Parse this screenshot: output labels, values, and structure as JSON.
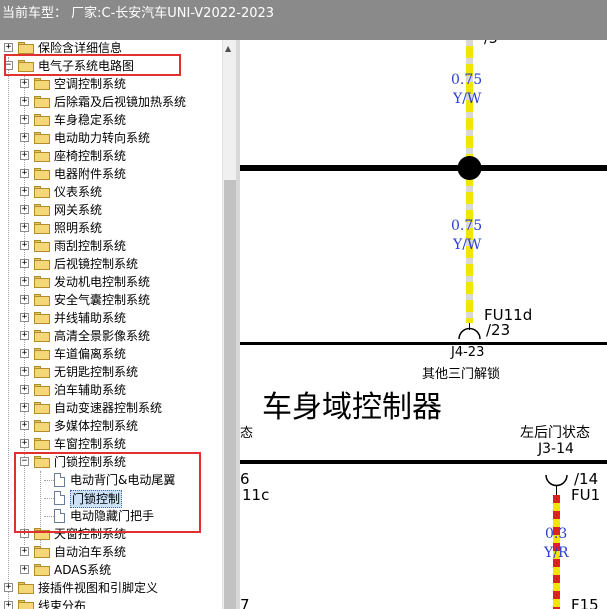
{
  "title": {
    "text": "当前车型：  厂家:C-长安汽车UNI-V2022-2023"
  },
  "tree": {
    "items": [
      {
        "label": "保险含详细信息",
        "level": 0,
        "state": "collapsed",
        "kind": "folder"
      },
      {
        "label": "电气子系统电路图",
        "level": 0,
        "state": "expanded",
        "kind": "folder"
      },
      {
        "label": "空调控制系统",
        "level": 1,
        "state": "collapsed",
        "kind": "folder"
      },
      {
        "label": "后除霜及后视镜加热系统",
        "level": 1,
        "state": "collapsed",
        "kind": "folder"
      },
      {
        "label": "车身稳定系统",
        "level": 1,
        "state": "collapsed",
        "kind": "folder"
      },
      {
        "label": "电动助力转向系统",
        "level": 1,
        "state": "collapsed",
        "kind": "folder"
      },
      {
        "label": "座椅控制系统",
        "level": 1,
        "state": "collapsed",
        "kind": "folder"
      },
      {
        "label": "电器附件系统",
        "level": 1,
        "state": "collapsed",
        "kind": "folder"
      },
      {
        "label": "仪表系统",
        "level": 1,
        "state": "collapsed",
        "kind": "folder"
      },
      {
        "label": "网关系统",
        "level": 1,
        "state": "collapsed",
        "kind": "folder"
      },
      {
        "label": "照明系统",
        "level": 1,
        "state": "collapsed",
        "kind": "folder"
      },
      {
        "label": "雨刮控制系统",
        "level": 1,
        "state": "collapsed",
        "kind": "folder"
      },
      {
        "label": "后视镜控制系统",
        "level": 1,
        "state": "collapsed",
        "kind": "folder"
      },
      {
        "label": "发动机电控制系统",
        "level": 1,
        "state": "collapsed",
        "kind": "folder"
      },
      {
        "label": "安全气囊控制系统",
        "level": 1,
        "state": "collapsed",
        "kind": "folder"
      },
      {
        "label": "并线辅助系统",
        "level": 1,
        "state": "collapsed",
        "kind": "folder"
      },
      {
        "label": "高清全景影像系统",
        "level": 1,
        "state": "collapsed",
        "kind": "folder"
      },
      {
        "label": "车道偏离系统",
        "level": 1,
        "state": "collapsed",
        "kind": "folder"
      },
      {
        "label": "无钥匙控制系统",
        "level": 1,
        "state": "collapsed",
        "kind": "folder"
      },
      {
        "label": "泊车辅助系统",
        "level": 1,
        "state": "collapsed",
        "kind": "folder"
      },
      {
        "label": "自动变速器控制系统",
        "level": 1,
        "state": "collapsed",
        "kind": "folder"
      },
      {
        "label": "多媒体控制系统",
        "level": 1,
        "state": "collapsed",
        "kind": "folder"
      },
      {
        "label": "车窗控制系统",
        "level": 1,
        "state": "collapsed",
        "kind": "folder"
      },
      {
        "label": "门锁控制系统",
        "level": 1,
        "state": "expanded",
        "kind": "folder"
      },
      {
        "label": "电动背门&电动尾翼",
        "level": 2,
        "state": "leaf",
        "kind": "doc"
      },
      {
        "label": "门锁控制",
        "level": 2,
        "state": "leaf",
        "kind": "doc",
        "selected": true
      },
      {
        "label": "电动隐藏门把手",
        "level": 2,
        "state": "leaf",
        "kind": "doc"
      },
      {
        "label": "天窗控制系统",
        "level": 1,
        "state": "collapsed",
        "kind": "folder"
      },
      {
        "label": "自动泊车系统",
        "level": 1,
        "state": "collapsed",
        "kind": "folder"
      },
      {
        "label": "ADAS系统",
        "level": 1,
        "state": "collapsed",
        "kind": "folder"
      },
      {
        "label": "接插件视图和引脚定义",
        "level": 0,
        "state": "collapsed",
        "kind": "folder"
      },
      {
        "label": "线束分布",
        "level": 0,
        "state": "collapsed",
        "kind": "folder"
      }
    ]
  },
  "diagram": {
    "wire1_size": "0.75",
    "wire1_color": "Y/W",
    "wire2_size": "0.75",
    "wire2_color": "Y/W",
    "top_pin_fragment": "/3",
    "fuse_label": "FU11d",
    "fuse_pin": "/23",
    "connector_pin": "J4-23",
    "connector_desc": "其他三门解锁",
    "module_title": "车身域控制器",
    "left_fragment": "态",
    "rear_door_status": "左后门状态",
    "rear_door_pin": "J3-14",
    "left_num_fragment": "6",
    "left_fuse_fragment": "11c",
    "pin14": "/14",
    "fu11_fragment": "FU1",
    "wire3_size": "0.3",
    "wire3_color": "Y/R",
    "bottom_left_fragment": "7",
    "bottom_fuse_fragment": "F15",
    "colors": {
      "wire_yellow": "#f2e600",
      "wire_stripe_white": "#d8d8d8",
      "wire_stripe_red": "#e02020",
      "label_blue": "#2b3fd4",
      "highlight_box": "#e03030"
    }
  }
}
